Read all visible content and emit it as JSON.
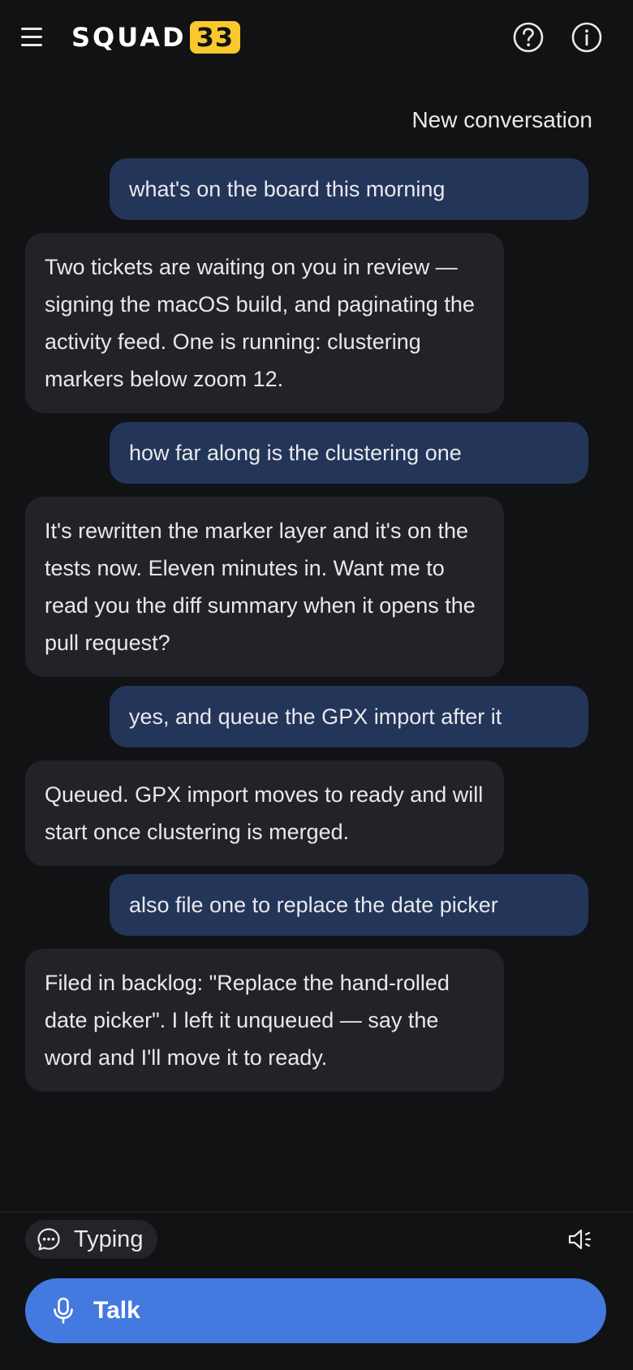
{
  "header": {
    "logo_text": "SQUAD",
    "logo_badge": "33",
    "menu_icon": "hamburger-menu-icon",
    "help_icon": "question-circle-icon",
    "info_icon": "info-circle-icon"
  },
  "conversation": {
    "new_label": "New conversation",
    "messages": [
      {
        "role": "user",
        "text": "what's on the board this morning"
      },
      {
        "role": "assistant",
        "text": "Two tickets are waiting on you in review — signing the macOS build, and paginating the activity feed. One is running: clustering markers below zoom 12."
      },
      {
        "role": "user",
        "text": "how far along is the clustering one"
      },
      {
        "role": "assistant",
        "text": "It's rewritten the marker layer and it's on the tests now. Eleven minutes in. Want me to read you the diff summary when it opens the pull request?"
      },
      {
        "role": "user",
        "text": "yes, and queue the GPX import after it"
      },
      {
        "role": "assistant",
        "text": "Queued. GPX import moves to ready and will start once clustering is merged."
      },
      {
        "role": "user",
        "text": "also file one to replace the date picker"
      },
      {
        "role": "assistant",
        "text": "Filed in backlog: \"Replace the hand-rolled date picker\". I left it unqueued — say the word and I'll move it to ready."
      }
    ]
  },
  "footer": {
    "typing_label": "Typing",
    "typing_icon": "chat-bubble-dots-icon",
    "speaker_icon": "speaker-icon",
    "talk_label": "Talk",
    "talk_icon": "microphone-icon"
  },
  "colors": {
    "background": "#111214",
    "user_bubble": "#233559",
    "assistant_bubble": "#222326",
    "accent": "#4479e0",
    "badge": "#f9c82c"
  }
}
